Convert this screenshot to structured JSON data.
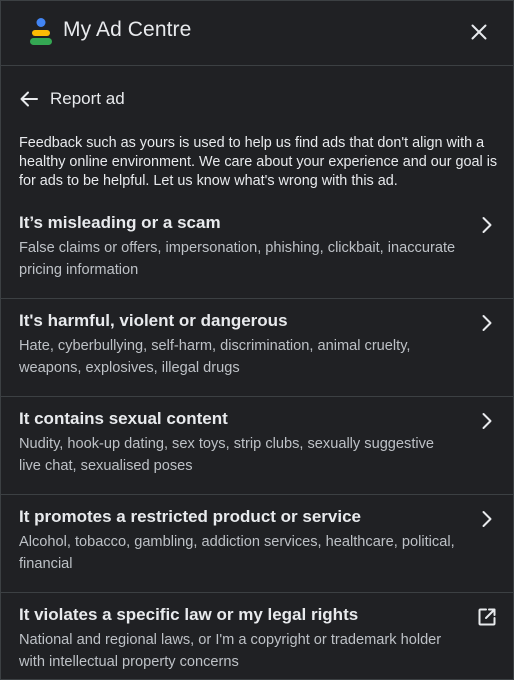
{
  "header": {
    "title": "My Ad Centre",
    "logo_icon": "my-ad-centre-logo",
    "close_icon": "close-icon"
  },
  "subheader": {
    "title": "Report ad",
    "back_icon": "back-arrow-icon"
  },
  "intro": "Feedback such as yours is used to help us find ads that don't align with a healthy online environment. We care about your experience and our goal is for ads to be helpful. Let us know what's wrong with this ad.",
  "options": [
    {
      "title": "It’s misleading or a scam",
      "description": "False claims or offers, impersonation, phishing, clickbait, inaccurate pricing information",
      "icon": "chevron-right-icon"
    },
    {
      "title": "It's harmful, violent or dangerous",
      "description": "Hate, cyberbullying, self-harm, discrimination, animal cruelty, weapons, explosives, illegal drugs",
      "icon": "chevron-right-icon"
    },
    {
      "title": "It contains sexual content",
      "description": "Nudity, hook-up dating, sex toys, strip clubs, sexually suggestive live chat, sexualised poses",
      "icon": "chevron-right-icon"
    },
    {
      "title": "It promotes a restricted product or service",
      "description": "Alcohol, tobacco, gambling, addiction services, healthcare, political, financial",
      "icon": "chevron-right-icon"
    },
    {
      "title": "It violates a specific law or my legal rights",
      "description": "National and regional laws, or I'm a copyright or trademark holder with intellectual property concerns",
      "icon": "open-in-new-icon"
    }
  ],
  "colors": {
    "background": "#202124",
    "text_primary": "#e8eaed",
    "text_secondary": "#bdc1c6",
    "divider": "#3c4043",
    "logo_yellow": "#fbbc04",
    "logo_green": "#34a853",
    "logo_blue": "#4285f4"
  }
}
